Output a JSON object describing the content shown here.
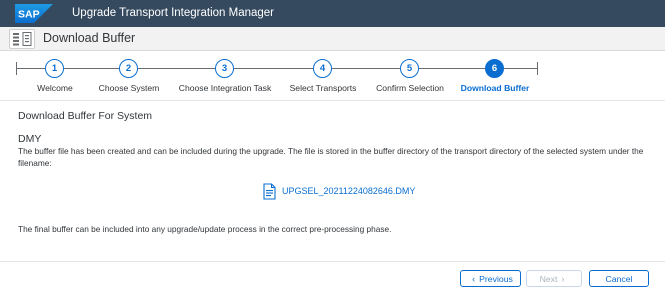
{
  "shell": {
    "logo": "SAP",
    "title": "Upgrade Transport Integration Manager"
  },
  "page": {
    "icon": "buffer-app-icon",
    "title": "Download Buffer"
  },
  "wizard": {
    "steps": [
      {
        "number": "1",
        "label": "Welcome"
      },
      {
        "number": "2",
        "label": "Choose System"
      },
      {
        "number": "3",
        "label": "Choose Integration Task"
      },
      {
        "number": "4",
        "label": "Select Transports"
      },
      {
        "number": "5",
        "label": "Confirm Selection"
      },
      {
        "number": "6",
        "label": "Download Buffer"
      }
    ],
    "active_step": 6
  },
  "content": {
    "section_title": "Download Buffer For System",
    "system": "DMY",
    "description": "The buffer file has been created and can be included during the upgrade. The file is stored in the buffer directory of the transport directory of the selected system under the filename:",
    "file_name": "UPGSEL_20211224082646.DMY",
    "final_text": "The final buffer can be included into any upgrade/update process in the correct pre-processing phase."
  },
  "footer": {
    "previous": "Previous",
    "next": "Next",
    "cancel": "Cancel",
    "previous_icon": "chevron-left-icon",
    "next_icon": "chevron-right-icon"
  },
  "colors": {
    "shell_bg": "#354a5f",
    "accent": "#0a6ed1",
    "text": "#32363a",
    "header_bg": "#f2f2f2"
  }
}
